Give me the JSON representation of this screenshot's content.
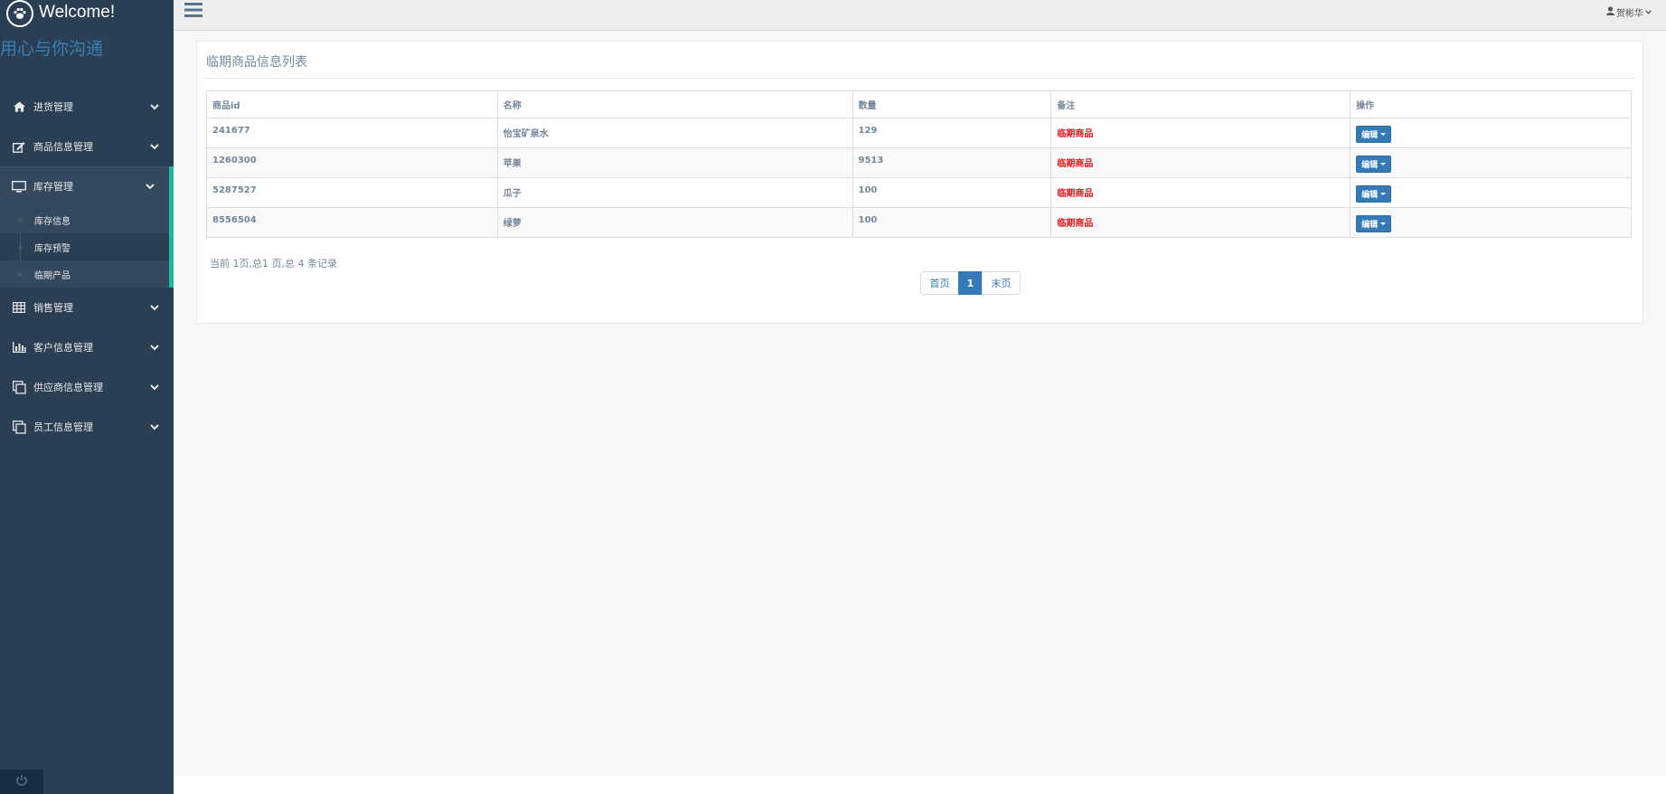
{
  "brand": {
    "title": "Welcome!",
    "slogan": "用心与你沟通"
  },
  "user": {
    "name": "贺彬华"
  },
  "menu": {
    "items": [
      {
        "label": "进货管理"
      },
      {
        "label": "商品信息管理"
      },
      {
        "label": "库存管理"
      },
      {
        "label": "销售管理"
      },
      {
        "label": "客户信息管理"
      },
      {
        "label": "供应商信息管理"
      },
      {
        "label": "员工信息管理"
      }
    ],
    "submenu": [
      {
        "label": "库存信息"
      },
      {
        "label": "库存预警"
      },
      {
        "label": "临期产品"
      }
    ]
  },
  "panel": {
    "title": "临期商品信息列表"
  },
  "table": {
    "headers": [
      "商品id",
      "名称",
      "数量",
      "备注",
      "操作"
    ],
    "rows": [
      {
        "id": "241677",
        "name": "怡宝矿泉水",
        "qty": "129",
        "note": "临期商品",
        "action": "编辑"
      },
      {
        "id": "1260300",
        "name": "苹果",
        "qty": "9513",
        "note": "临期商品",
        "action": "编辑"
      },
      {
        "id": "5287527",
        "name": "瓜子",
        "qty": "100",
        "note": "临期商品",
        "action": "编辑"
      },
      {
        "id": "8556504",
        "name": "绿萝",
        "qty": "100",
        "note": "临期商品",
        "action": "编辑"
      }
    ]
  },
  "pagination": {
    "summary": "当前 1页,总1 页,总 4 条记录",
    "first": "首页",
    "current": "1",
    "last": "末页"
  },
  "colors": {
    "sidebar": "#2a3f54",
    "accent": "#1abb9c",
    "primary": "#337ab7",
    "warning_text": "#e6161c"
  }
}
